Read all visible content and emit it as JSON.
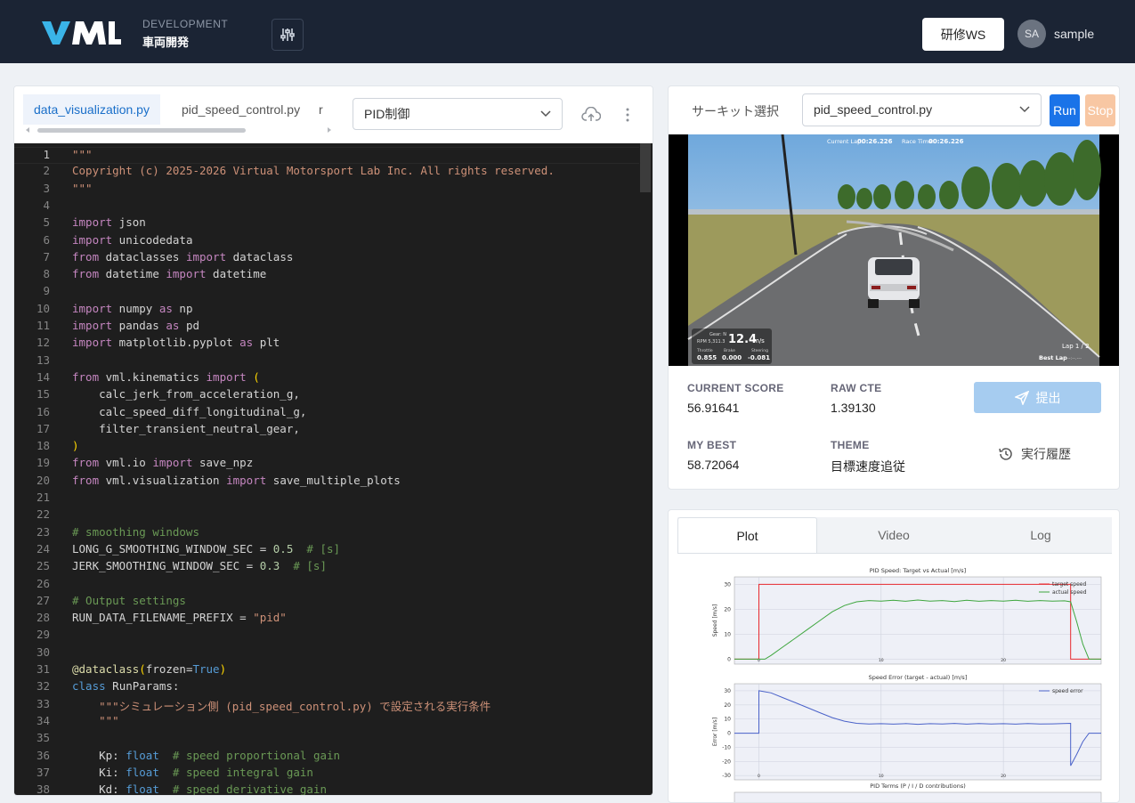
{
  "header": {
    "logo_text": "VML",
    "dept_label": "DEVELOPMENT",
    "dept_name": "車両開発",
    "workspace_button": "研修WS",
    "avatar_initials": "SA",
    "username": "sample"
  },
  "editor": {
    "tabs": [
      {
        "label": "data_visualization.py",
        "active": true
      },
      {
        "label": "pid_speed_control.py",
        "active": false
      },
      {
        "label": "r",
        "active": false
      }
    ],
    "mode_select": "PID制御",
    "current_line": 1,
    "lines": [
      {
        "n": "1",
        "html": "<span class='t-str'>\"\"\"</span>"
      },
      {
        "n": "2",
        "html": "<span class='t-str'>Copyright (c) 2025-2026 Virtual Motorsport Lab Inc. All rights reserved.</span>"
      },
      {
        "n": "3",
        "html": "<span class='t-str'>\"\"\"</span>"
      },
      {
        "n": "4",
        "html": ""
      },
      {
        "n": "5",
        "html": "<span class='t-imp'>import</span> json"
      },
      {
        "n": "6",
        "html": "<span class='t-imp'>import</span> unicodedata"
      },
      {
        "n": "7",
        "html": "<span class='t-imp'>from</span> dataclasses <span class='t-imp'>import</span> dataclass"
      },
      {
        "n": "8",
        "html": "<span class='t-imp'>from</span> datetime <span class='t-imp'>import</span> datetime"
      },
      {
        "n": "9",
        "html": ""
      },
      {
        "n": "10",
        "html": "<span class='t-imp'>import</span> numpy <span class='t-imp'>as</span> np"
      },
      {
        "n": "11",
        "html": "<span class='t-imp'>import</span> pandas <span class='t-imp'>as</span> pd"
      },
      {
        "n": "12",
        "html": "<span class='t-imp'>import</span> matplotlib.pyplot <span class='t-imp'>as</span> plt"
      },
      {
        "n": "13",
        "html": ""
      },
      {
        "n": "14",
        "html": "<span class='t-imp'>from</span> vml.kinematics <span class='t-imp'>import</span> <span class='t-br'>(</span>"
      },
      {
        "n": "15",
        "html": "    calc_jerk_from_acceleration_g,"
      },
      {
        "n": "16",
        "html": "    calc_speed_diff_longitudinal_g,"
      },
      {
        "n": "17",
        "html": "    filter_transient_neutral_gear,"
      },
      {
        "n": "18",
        "html": "<span class='t-br'>)</span>"
      },
      {
        "n": "19",
        "html": "<span class='t-imp'>from</span> vml.io <span class='t-imp'>import</span> save_npz"
      },
      {
        "n": "20",
        "html": "<span class='t-imp'>from</span> vml.visualization <span class='t-imp'>import</span> save_multiple_plots"
      },
      {
        "n": "21",
        "html": ""
      },
      {
        "n": "22",
        "html": ""
      },
      {
        "n": "23",
        "html": "<span class='t-cmt'># smoothing windows</span>"
      },
      {
        "n": "24",
        "html": "LONG_G_SMOOTHING_WINDOW_SEC = <span class='t-num'>0.5</span>  <span class='t-cmt'># [s]</span>"
      },
      {
        "n": "25",
        "html": "JERK_SMOOTHING_WINDOW_SEC = <span class='t-num'>0.3</span>  <span class='t-cmt'># [s]</span>"
      },
      {
        "n": "26",
        "html": ""
      },
      {
        "n": "27",
        "html": "<span class='t-cmt'># Output settings</span>"
      },
      {
        "n": "28",
        "html": "RUN_DATA_FILENAME_PREFIX = <span class='t-str'>\"pid\"</span>"
      },
      {
        "n": "29",
        "html": ""
      },
      {
        "n": "30",
        "html": ""
      },
      {
        "n": "31",
        "html": "<span class='t-dec'>@dataclass</span><span class='t-br'>(</span>frozen=<span class='t-kw'>True</span><span class='t-br'>)</span>"
      },
      {
        "n": "32",
        "html": "<span class='t-kw'>class</span> RunParams:"
      },
      {
        "n": "33",
        "html": "    <span class='t-str'>\"\"\"シミュレーション側 (pid_speed_control.py) で設定される実行条件</span>"
      },
      {
        "n": "34",
        "html": "    <span class='t-str'>\"\"\"</span>"
      },
      {
        "n": "35",
        "html": ""
      },
      {
        "n": "36",
        "html": "    Kp: <span class='t-kw'>float</span>  <span class='t-cmt'># speed proportional gain</span>"
      },
      {
        "n": "37",
        "html": "    Ki: <span class='t-kw'>float</span>  <span class='t-cmt'># speed integral gain</span>"
      },
      {
        "n": "38",
        "html": "    Kd: <span class='t-kw'>float</span>  <span class='t-cmt'># speed derivative gain</span>"
      }
    ]
  },
  "sim": {
    "circuit_label": "サーキット選択",
    "circuit_value": "pid_speed_control.py",
    "run_label": "Run",
    "stop_label": "Stop",
    "hud": {
      "current_lap_label": "Current Lap:",
      "current_lap": "00:26.226",
      "race_time_label": "Race Time:",
      "race_time": "00:26.226",
      "speed": "12.4",
      "speed_unit": "m/s",
      "gear_label": "Gear: N",
      "rpm_label": "RPM 5,311.3",
      "throttle_label": "Throttle",
      "throttle": "0.855",
      "brake_label": "Brake",
      "brake": "0.000",
      "steering_label": "Steering",
      "steering": "-0.081",
      "lap_label": "Lap 1 / 2",
      "best_lap_label": "Best Lap",
      "best_lap_value": "--:--.---"
    },
    "stats": {
      "current_score_label": "CURRENT SCORE",
      "current_score": "56.91641",
      "raw_cte_label": "RAW CTE",
      "raw_cte": "1.39130",
      "my_best_label": "MY BEST",
      "my_best": "58.72064",
      "theme_label": "THEME",
      "theme": "目標速度追従"
    },
    "submit_label": "提出",
    "history_label": "実行履歴"
  },
  "results": {
    "tabs": [
      {
        "label": "Plot",
        "active": true
      },
      {
        "label": "Video",
        "active": false
      },
      {
        "label": "Log",
        "active": false
      }
    ]
  },
  "chart_data": [
    {
      "type": "line",
      "title": "PID Speed: Target vs Actual [m/s]",
      "ylabel": "Speed [m/s]",
      "xlabel": "",
      "xlim": [
        -2,
        28
      ],
      "ylim": [
        -2,
        33
      ],
      "yticks": [
        0,
        10,
        20,
        30
      ],
      "xticks": [
        0,
        10,
        20
      ],
      "series": [
        {
          "name": "target speed",
          "color": "#e8282e",
          "x": [
            -2,
            0,
            0,
            25.5,
            25.5,
            28
          ],
          "y": [
            0,
            0,
            30,
            30,
            0,
            0
          ]
        },
        {
          "name": "actual speed",
          "color": "#3ea63e",
          "x": [
            -2,
            0.5,
            1,
            2,
            3,
            4,
            5,
            6,
            7,
            8,
            9,
            10,
            11,
            12,
            13,
            14,
            15,
            16,
            17,
            18,
            19,
            20,
            21,
            22,
            23,
            24,
            25,
            25.5,
            26,
            26.5,
            27,
            28
          ],
          "y": [
            0,
            0,
            1.5,
            5,
            8.5,
            12,
            15.5,
            19,
            21.5,
            23,
            23.5,
            23.3,
            23.6,
            23.2,
            23.7,
            23.3,
            23.5,
            23.1,
            23.6,
            23.2,
            23.5,
            23.3,
            23.6,
            23.2,
            23.5,
            23.3,
            23.4,
            23,
            15,
            6,
            0,
            0
          ]
        }
      ]
    },
    {
      "type": "line",
      "title": "Speed Error (target - actual) [m/s]",
      "ylabel": "Error [m/s]",
      "xlabel": "",
      "xlim": [
        -2,
        28
      ],
      "ylim": [
        -33,
        35
      ],
      "yticks": [
        -30,
        -20,
        -10,
        0,
        10,
        20,
        30
      ],
      "xticks": [
        0,
        10,
        20
      ],
      "series": [
        {
          "name": "speed error",
          "color": "#4a62c9",
          "x": [
            -2,
            0,
            0,
            1,
            2,
            3,
            4,
            5,
            6,
            7,
            8,
            9,
            10,
            11,
            12,
            13,
            14,
            15,
            16,
            17,
            18,
            19,
            20,
            21,
            22,
            23,
            24,
            25.5,
            25.5,
            26,
            26.5,
            27,
            28
          ],
          "y": [
            0,
            0,
            30,
            28.5,
            25,
            21.5,
            18,
            14.5,
            11,
            8.5,
            7,
            6.5,
            6.7,
            6.4,
            6.8,
            6.3,
            6.7,
            6.5,
            6.9,
            6.4,
            6.8,
            6.5,
            6.7,
            6.4,
            6.8,
            6.5,
            6.6,
            7,
            -23,
            -15,
            -6,
            0,
            0
          ]
        }
      ]
    },
    {
      "type": "line",
      "title": "PID Terms (P / I / D contributions)",
      "series": []
    }
  ]
}
